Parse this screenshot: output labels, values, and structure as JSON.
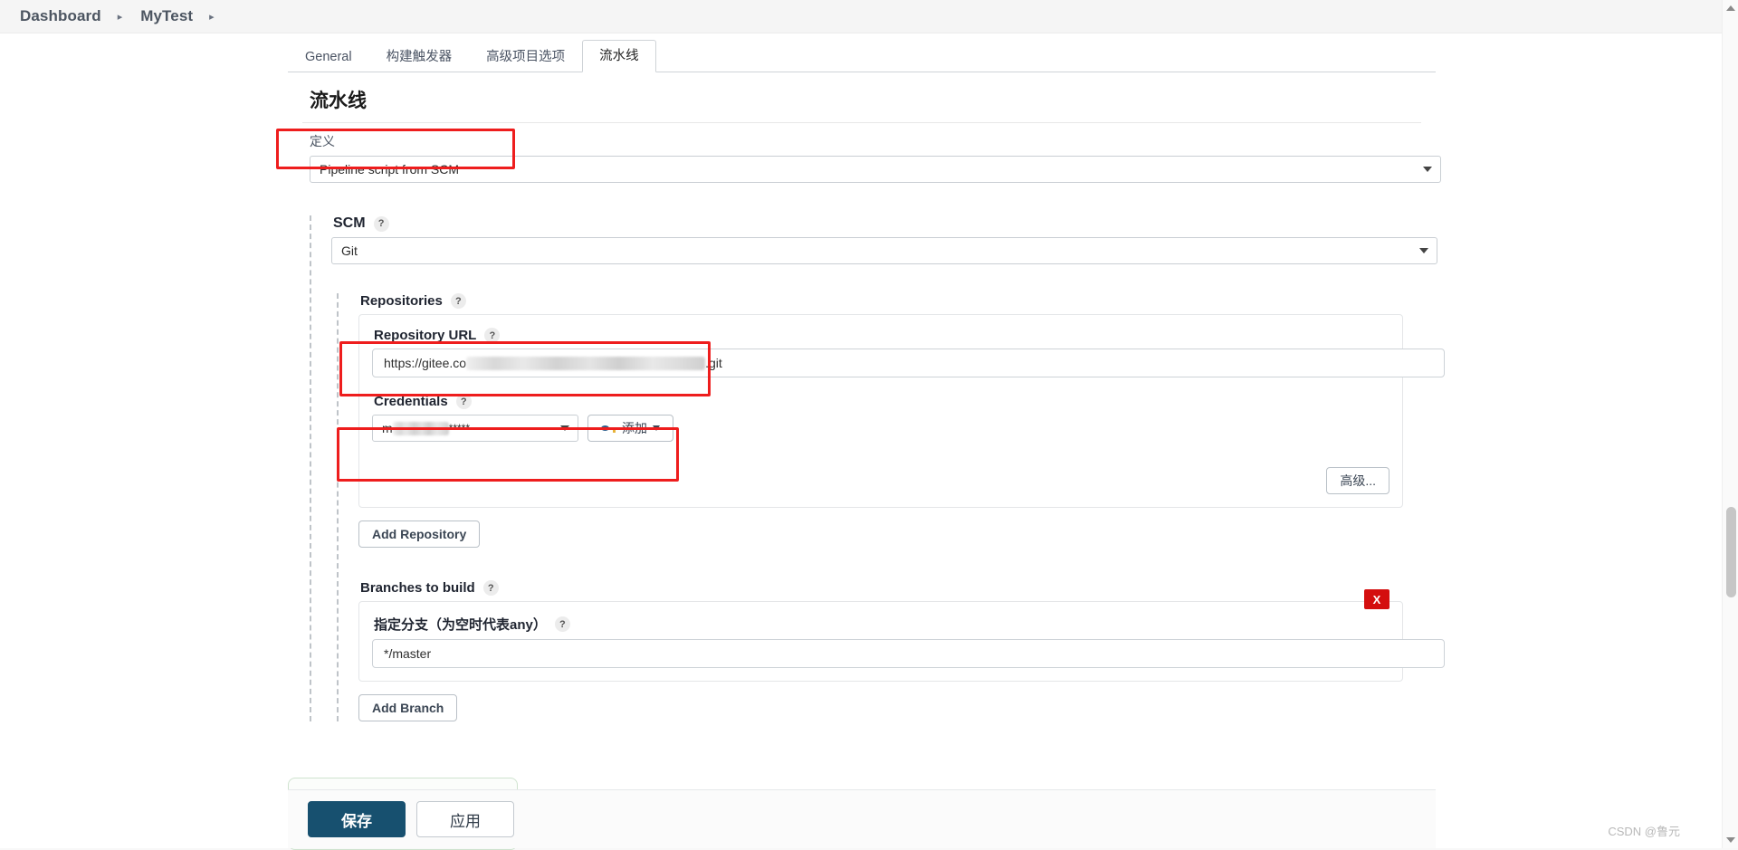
{
  "breadcrumb": {
    "items": [
      {
        "label": "Dashboard"
      },
      {
        "label": "MyTest"
      }
    ],
    "separator": "▸"
  },
  "tabs": [
    {
      "label": "General",
      "active": false
    },
    {
      "label": "构建触发器",
      "active": false
    },
    {
      "label": "高级项目选项",
      "active": false
    },
    {
      "label": "流水线",
      "active": true
    }
  ],
  "main": {
    "section_title": "流水线",
    "definition": {
      "label": "定义",
      "value": "Pipeline script from SCM"
    },
    "scm": {
      "label": "SCM",
      "help": "?",
      "value": "Git"
    },
    "repositories": {
      "label": "Repositories",
      "help": "?",
      "repository_url": {
        "label": "Repository URL",
        "help": "?",
        "value_prefix": "https://gitee.co",
        "value_redacted": true,
        "value_suffix": ".git"
      },
      "credentials": {
        "label": "Credentials",
        "help": "?",
        "value_prefix": "m",
        "value_redacted": true,
        "value_suffix": "*****",
        "add_button": {
          "label": "添加",
          "icon": "key-icon",
          "caret": "▾"
        }
      },
      "advanced_button": "高级...",
      "add_repository_button": "Add Repository"
    },
    "branches": {
      "label": "Branches to build",
      "help": "?",
      "specifier": {
        "label": "指定分支（为空时代表any）",
        "help": "?",
        "value": "*/master"
      },
      "delete_button": "X",
      "add_branch_button": "Add Branch"
    }
  },
  "footer": {
    "save_label": "保存",
    "apply_label": "应用"
  },
  "watermark": "CSDN @鲁元",
  "colors": {
    "annotation_red": "#ee1d1d",
    "save_navy": "#17506f",
    "delete_red": "#d40f0f"
  }
}
